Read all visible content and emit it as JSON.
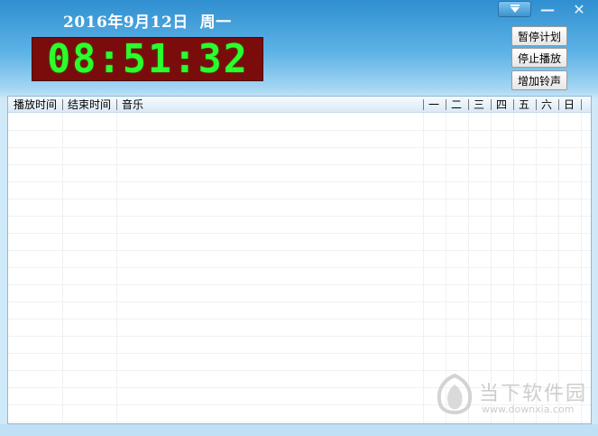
{
  "header": {
    "date_text": "2016年9月12日",
    "weekday_text": "周一",
    "clock_text": "08:51:32"
  },
  "window_controls": {
    "menu_icon": "dropdown-arrow-icon",
    "minimize_glyph": "—",
    "close_glyph": "✕"
  },
  "actions": {
    "pause_plan": "暂停计划",
    "stop_play": "停止播放",
    "add_ringtone": "增加铃声"
  },
  "table": {
    "columns": {
      "start_time": "播放时间",
      "end_time": "结束时间",
      "music": "音乐",
      "mon": "一",
      "tue": "二",
      "wed": "三",
      "thu": "四",
      "fri": "五",
      "sat": "六",
      "sun": "日"
    },
    "rows": []
  },
  "watermark": {
    "cn_text": "当下软件园",
    "url_text": "www.downxia.com"
  },
  "colors": {
    "clock_bg": "#7a0c0c",
    "clock_digits": "#2bff2b",
    "title_bar": "#2f8fd0"
  }
}
